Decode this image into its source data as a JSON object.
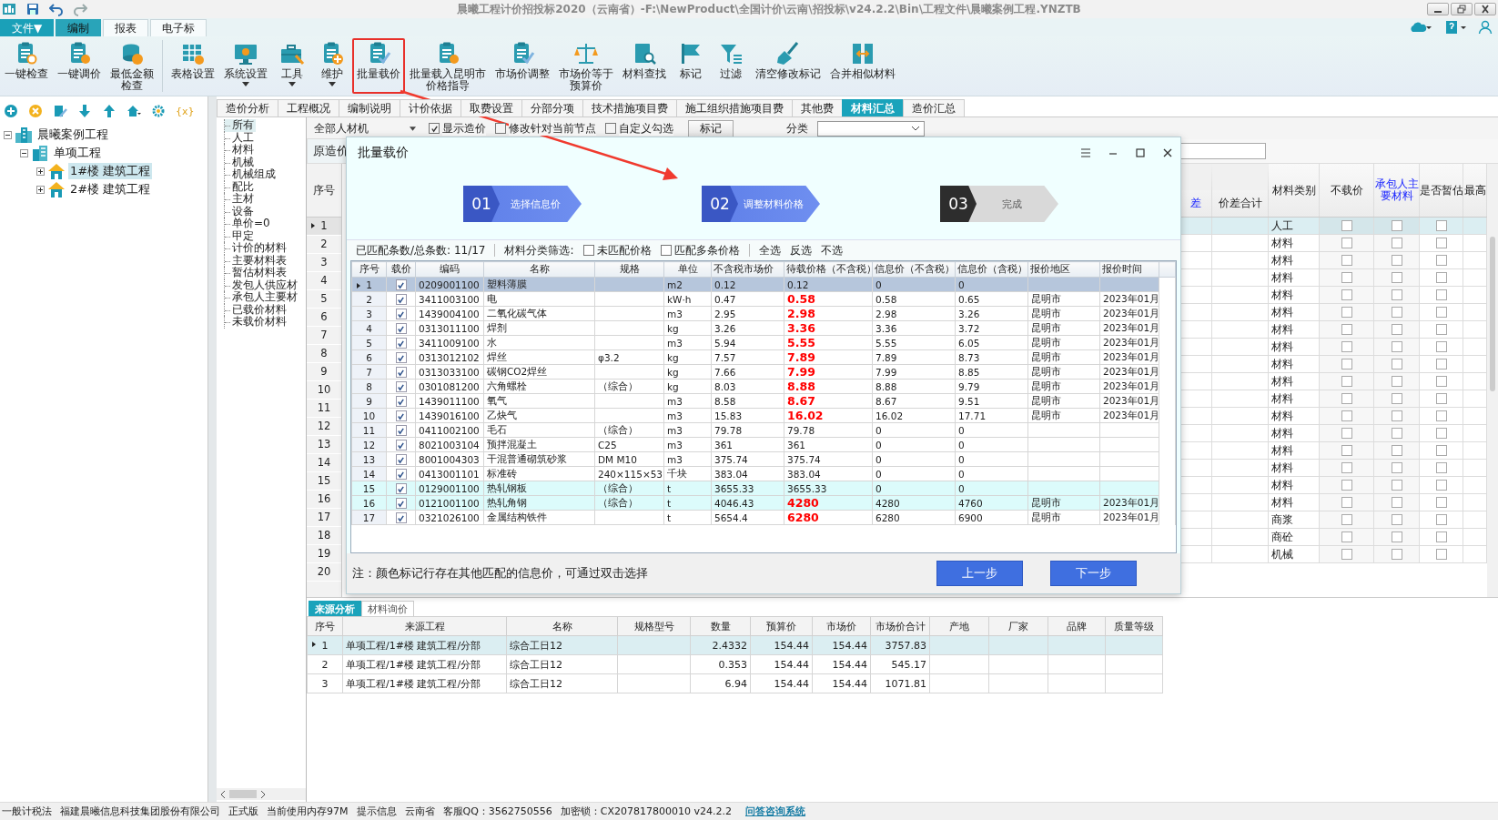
{
  "window": {
    "title": "晨曦工程计价招投标2020（云南省）-F:\\NewProduct\\全国计价\\云南\\招投标\\v24.2.2\\Bin\\工程文件\\晨曦案例工程.YNZTB"
  },
  "menu_tabs": [
    {
      "label": "文件▼",
      "kind": "file",
      "selected": false
    },
    {
      "label": "编制",
      "kind": "tab",
      "selected": true
    },
    {
      "label": "报表",
      "kind": "tab",
      "selected": false
    },
    {
      "label": "电子标",
      "kind": "tab",
      "selected": false
    }
  ],
  "ribbon": [
    {
      "items": [
        {
          "lines": [
            "一键检查"
          ],
          "dropdown": false,
          "highlighted": false
        },
        {
          "lines": [
            "一键调价"
          ],
          "dropdown": false,
          "highlighted": false
        },
        {
          "lines": [
            "最低金额",
            "检查"
          ],
          "dropdown": false,
          "highlighted": false
        }
      ]
    },
    {
      "items": [
        {
          "lines": [
            "表格设置"
          ],
          "dropdown": false,
          "highlighted": false
        },
        {
          "lines": [
            "系统设置"
          ],
          "dropdown": true,
          "highlighted": false
        },
        {
          "lines": [
            "工具"
          ],
          "dropdown": true,
          "highlighted": false
        },
        {
          "lines": [
            "维护"
          ],
          "dropdown": true,
          "highlighted": false
        },
        {
          "lines": [
            "批量载价"
          ],
          "dropdown": false,
          "highlighted": true
        },
        {
          "lines": [
            "批量载入昆明市",
            "价格指导"
          ],
          "dropdown": false,
          "highlighted": false
        },
        {
          "lines": [
            "市场价调整"
          ],
          "dropdown": false,
          "highlighted": false
        },
        {
          "lines": [
            "市场价等于",
            "预算价"
          ],
          "dropdown": false,
          "highlighted": false
        },
        {
          "lines": [
            "材料查找"
          ],
          "dropdown": false,
          "highlighted": false
        },
        {
          "lines": [
            "标记"
          ],
          "dropdown": false,
          "highlighted": false
        },
        {
          "lines": [
            "过滤"
          ],
          "dropdown": false,
          "highlighted": false
        },
        {
          "lines": [
            "清空修改标记"
          ],
          "dropdown": false,
          "highlighted": false
        },
        {
          "lines": [
            "合并相似材料"
          ],
          "dropdown": false,
          "highlighted": false
        }
      ]
    }
  ],
  "left_toolbar": {
    "tools": [
      {
        "kind": "add"
      },
      {
        "kind": "remove"
      },
      {
        "kind": "edit"
      },
      {
        "kind": "down"
      },
      {
        "kind": "up"
      },
      {
        "kind": "home"
      },
      {
        "kind": "gear"
      }
    ],
    "variable_button": "{x}"
  },
  "tree": {
    "nodes": [
      {
        "label": "晨曦案例工程",
        "kind": "project",
        "expanded": true,
        "selected": false,
        "children": [
          {
            "label": "单项工程",
            "kind": "building",
            "expanded": true,
            "selected": false,
            "children": [
              {
                "label": "1#楼  建筑工程",
                "kind": "house",
                "expanded": false,
                "selected": true
              },
              {
                "label": "2#楼  建筑工程",
                "kind": "house",
                "expanded": false,
                "selected": false
              }
            ]
          }
        ]
      }
    ]
  },
  "main_tabs": [
    {
      "label": "造价分析",
      "selected": false
    },
    {
      "label": "工程概况",
      "selected": false
    },
    {
      "label": "编制说明",
      "selected": false
    },
    {
      "label": "计价依据",
      "selected": false
    },
    {
      "label": "取费设置",
      "selected": false
    },
    {
      "label": "分部分项",
      "selected": false
    },
    {
      "label": "技术措施项目费",
      "selected": false
    },
    {
      "label": "施工组织措施项目费",
      "selected": false
    },
    {
      "label": "其他费",
      "selected": false
    },
    {
      "label": "材料汇总",
      "selected": true
    },
    {
      "label": "造价汇总",
      "selected": false
    }
  ],
  "filter_list": [
    {
      "label": "所有",
      "selected": true
    },
    {
      "label": "人工",
      "selected": false
    },
    {
      "label": "材料",
      "selected": false
    },
    {
      "label": "机械",
      "selected": false
    },
    {
      "label": "机械组成",
      "selected": false
    },
    {
      "label": "配比",
      "selected": false
    },
    {
      "label": "主材",
      "selected": false
    },
    {
      "label": "设备",
      "selected": false
    },
    {
      "label": "单价=0",
      "selected": false
    },
    {
      "label": "甲定",
      "selected": false
    },
    {
      "label": "计价的材料",
      "selected": false
    },
    {
      "label": "主要材料表",
      "selected": false
    },
    {
      "label": "暂估材料表",
      "selected": false
    },
    {
      "label": "发包人供应材",
      "selected": false
    },
    {
      "label": "承包人主要材",
      "selected": false
    },
    {
      "label": "已载价材料",
      "selected": false
    },
    {
      "label": "未载价材料",
      "selected": false
    }
  ],
  "filter_bar": {
    "material_select": "全部人材机",
    "options": [
      {
        "label": "显示造价",
        "checked": true
      },
      {
        "label": "修改针对当前节点",
        "checked": false
      },
      {
        "label": "自定义勾选",
        "checked": false
      }
    ],
    "mark_button": "标记",
    "category_label": "分类"
  },
  "material_grid": {
    "group_header": "原造价",
    "row_header": "序号",
    "columns": [
      {
        "label": "差",
        "emphasis": true,
        "kind": "text"
      },
      {
        "label": "价差合计",
        "emphasis": false,
        "kind": "text"
      },
      {
        "label": "材料类别",
        "emphasis": false,
        "kind": "category"
      },
      {
        "label": "不载价",
        "emphasis": false,
        "kind": "no_price"
      },
      {
        "label": "承包人主要材料",
        "emphasis": true,
        "kind": "contractor_main"
      },
      {
        "label": "是否暂估",
        "emphasis": false,
        "kind": "provisional"
      },
      {
        "label": "最高",
        "emphasis": false,
        "kind": "text"
      }
    ],
    "rows": [
      {
        "no": "1",
        "category": "人工",
        "selected": true,
        "no_price": false,
        "contractor_main": false,
        "provisional": false
      },
      {
        "no": "2",
        "category": "材料",
        "selected": false,
        "no_price": false,
        "contractor_main": false,
        "provisional": false
      },
      {
        "no": "3",
        "category": "材料",
        "selected": false,
        "no_price": false,
        "contractor_main": false,
        "provisional": false
      },
      {
        "no": "4",
        "category": "材料",
        "selected": false,
        "no_price": false,
        "contractor_main": false,
        "provisional": false
      },
      {
        "no": "5",
        "category": "材料",
        "selected": false,
        "no_price": false,
        "contractor_main": false,
        "provisional": false
      },
      {
        "no": "6",
        "category": "材料",
        "selected": false,
        "no_price": false,
        "contractor_main": false,
        "provisional": false
      },
      {
        "no": "7",
        "category": "材料",
        "selected": false,
        "no_price": false,
        "contractor_main": false,
        "provisional": false
      },
      {
        "no": "8",
        "category": "材料",
        "selected": false,
        "no_price": false,
        "contractor_main": false,
        "provisional": false
      },
      {
        "no": "9",
        "category": "材料",
        "selected": false,
        "no_price": false,
        "contractor_main": false,
        "provisional": false
      },
      {
        "no": "10",
        "category": "材料",
        "selected": false,
        "no_price": false,
        "contractor_main": false,
        "provisional": false
      },
      {
        "no": "11",
        "category": "材料",
        "selected": false,
        "no_price": false,
        "contractor_main": false,
        "provisional": false
      },
      {
        "no": "12",
        "category": "材料",
        "selected": false,
        "no_price": false,
        "contractor_main": false,
        "provisional": false
      },
      {
        "no": "13",
        "category": "材料",
        "selected": false,
        "no_price": false,
        "contractor_main": false,
        "provisional": false
      },
      {
        "no": "14",
        "category": "材料",
        "selected": false,
        "no_price": false,
        "contractor_main": false,
        "provisional": false
      },
      {
        "no": "15",
        "category": "材料",
        "selected": false,
        "no_price": false,
        "contractor_main": false,
        "provisional": false
      },
      {
        "no": "16",
        "category": "材料",
        "selected": false,
        "no_price": false,
        "contractor_main": false,
        "provisional": false
      },
      {
        "no": "17",
        "category": "材料",
        "selected": false,
        "no_price": false,
        "contractor_main": false,
        "provisional": false
      },
      {
        "no": "18",
        "category": "商浆",
        "selected": false,
        "no_price": false,
        "contractor_main": false,
        "provisional": false
      },
      {
        "no": "19",
        "category": "商砼",
        "selected": false,
        "no_price": false,
        "contractor_main": false,
        "provisional": false
      },
      {
        "no": "20",
        "category": "机械",
        "selected": false,
        "no_price": false,
        "contractor_main": false,
        "provisional": false
      }
    ]
  },
  "dialog": {
    "title": "批量载价",
    "steps": [
      {
        "number": "01",
        "label": "选择信息价",
        "active": true
      },
      {
        "number": "02",
        "label": "调整材料价格",
        "active": true
      },
      {
        "number": "03",
        "label": "完成",
        "active": false
      }
    ],
    "match_count": "已匹配条数/总条数:  11/17",
    "category_filter_label": "材料分类筛选:",
    "filters": [
      {
        "label": "未匹配价格",
        "checked": false
      },
      {
        "label": "匹配多条价格",
        "checked": false
      }
    ],
    "select_actions": [
      "全选",
      "反选",
      "不选"
    ],
    "columns": [
      "序号",
      "载价",
      "编码",
      "名称",
      "规格",
      "单位",
      "不含税市场价",
      "待载价格（不含税）",
      "信息价（不含税）",
      "信息价（含税）",
      "报价地区",
      "报价时间"
    ],
    "rows": [
      {
        "no": "1",
        "checked": true,
        "code": "0209001100",
        "name": "塑料薄膜",
        "unit": "m2",
        "market": "0.12",
        "pending": "0.12",
        "info_ex": "0",
        "info_in": "0",
        "changed": false,
        "marked": false,
        "selected": true
      },
      {
        "no": "2",
        "checked": true,
        "code": "3411003100",
        "name": "电",
        "unit": "kW·h",
        "market": "0.47",
        "pending": "0.58",
        "info_ex": "0.58",
        "info_in": "0.65",
        "region": "昆明市",
        "time": "2023年01月",
        "changed": true,
        "marked": false,
        "selected": false
      },
      {
        "no": "3",
        "checked": true,
        "code": "1439004100",
        "name": "二氧化碳气体",
        "unit": "m3",
        "market": "2.95",
        "pending": "2.98",
        "info_ex": "2.98",
        "info_in": "3.26",
        "region": "昆明市",
        "time": "2023年01月",
        "changed": true,
        "marked": false,
        "selected": false
      },
      {
        "no": "4",
        "checked": true,
        "code": "0313011100",
        "name": "焊剂",
        "unit": "kg",
        "market": "3.26",
        "pending": "3.36",
        "info_ex": "3.36",
        "info_in": "3.72",
        "region": "昆明市",
        "time": "2023年01月",
        "changed": true,
        "marked": false,
        "selected": false
      },
      {
        "no": "5",
        "checked": true,
        "code": "3411009100",
        "name": "水",
        "unit": "m3",
        "market": "5.94",
        "pending": "5.55",
        "info_ex": "5.55",
        "info_in": "6.05",
        "region": "昆明市",
        "time": "2023年01月",
        "changed": true,
        "marked": false,
        "selected": false
      },
      {
        "no": "6",
        "checked": true,
        "code": "0313012102",
        "name": "焊丝",
        "spec": "φ3.2",
        "unit": "kg",
        "market": "7.57",
        "pending": "7.89",
        "info_ex": "7.89",
        "info_in": "8.73",
        "region": "昆明市",
        "time": "2023年01月",
        "changed": true,
        "marked": false,
        "selected": false
      },
      {
        "no": "7",
        "checked": true,
        "code": "0313033100",
        "name": "碳钢CO2焊丝",
        "unit": "kg",
        "market": "7.66",
        "pending": "7.99",
        "info_ex": "7.99",
        "info_in": "8.85",
        "region": "昆明市",
        "time": "2023年01月",
        "changed": true,
        "marked": false,
        "selected": false
      },
      {
        "no": "8",
        "checked": true,
        "code": "0301081200",
        "name": "六角螺栓",
        "spec": "（综合）",
        "unit": "kg",
        "market": "8.03",
        "pending": "8.88",
        "info_ex": "8.88",
        "info_in": "9.79",
        "region": "昆明市",
        "time": "2023年01月",
        "changed": true,
        "marked": false,
        "selected": false
      },
      {
        "no": "9",
        "checked": true,
        "code": "1439011100",
        "name": "氧气",
        "unit": "m3",
        "market": "8.58",
        "pending": "8.67",
        "info_ex": "8.67",
        "info_in": "9.51",
        "region": "昆明市",
        "time": "2023年01月",
        "changed": true,
        "marked": false,
        "selected": false
      },
      {
        "no": "10",
        "checked": true,
        "code": "1439016100",
        "name": "乙炔气",
        "unit": "m3",
        "market": "15.83",
        "pending": "16.02",
        "info_ex": "16.02",
        "info_in": "17.71",
        "region": "昆明市",
        "time": "2023年01月",
        "changed": true,
        "marked": false,
        "selected": false
      },
      {
        "no": "11",
        "checked": true,
        "code": "0411002100",
        "name": "毛石",
        "spec": "（综合）",
        "unit": "m3",
        "market": "79.78",
        "pending": "79.78",
        "info_ex": "0",
        "info_in": "0",
        "changed": false,
        "marked": false,
        "selected": false
      },
      {
        "no": "12",
        "checked": true,
        "code": "8021003104",
        "name": "预拌混凝土",
        "spec": "C25",
        "unit": "m3",
        "market": "361",
        "pending": "361",
        "info_ex": "0",
        "info_in": "0",
        "changed": false,
        "marked": false,
        "selected": false
      },
      {
        "no": "13",
        "checked": true,
        "code": "8001004303",
        "name": "干混普通砌筑砂浆",
        "spec": "DM M10",
        "unit": "m3",
        "market": "375.74",
        "pending": "375.74",
        "info_ex": "0",
        "info_in": "0",
        "changed": false,
        "marked": false,
        "selected": false
      },
      {
        "no": "14",
        "checked": true,
        "code": "0413001101",
        "name": "标准砖",
        "spec": "240×115×53",
        "unit": "千块",
        "market": "383.04",
        "pending": "383.04",
        "info_ex": "0",
        "info_in": "0",
        "changed": false,
        "marked": false,
        "selected": false
      },
      {
        "no": "15",
        "checked": true,
        "code": "0129001100",
        "name": "热轧钢板",
        "spec": "（综合）",
        "unit": "t",
        "market": "3655.33",
        "pending": "3655.33",
        "info_ex": "0",
        "info_in": "0",
        "changed": false,
        "marked": true,
        "selected": false
      },
      {
        "no": "16",
        "checked": true,
        "code": "0121001100",
        "name": "热轧角钢",
        "spec": "（综合）",
        "unit": "t",
        "market": "4046.43",
        "pending": "4280",
        "info_ex": "4280",
        "info_in": "4760",
        "region": "昆明市",
        "time": "2023年01月",
        "changed": true,
        "marked": true,
        "selected": false
      },
      {
        "no": "17",
        "checked": true,
        "code": "0321026100",
        "name": "金属结构铁件",
        "unit": "t",
        "market": "5654.4",
        "pending": "6280",
        "info_ex": "6280",
        "info_in": "6900",
        "region": "昆明市",
        "time": "2023年01月",
        "changed": true,
        "marked": false,
        "selected": false
      }
    ],
    "note": "注：颜色标记行存在其他匹配的信息价，可通过双击选择",
    "back_button": "上一步",
    "next_button": "下一步"
  },
  "bottom_tabs": [
    {
      "label": "来源分析",
      "selected": true
    },
    {
      "label": "材料询价",
      "selected": false
    }
  ],
  "source_table": {
    "columns": [
      "序号",
      "来源工程",
      "名称",
      "规格型号",
      "数量",
      "预算价",
      "市场价",
      "市场价合计",
      "产地",
      "厂家",
      "品牌",
      "质量等级"
    ],
    "rows": [
      {
        "no": "1",
        "project": "单项工程/1#楼 建筑工程/分部",
        "name": "综合工日12",
        "qty": "2.4332",
        "budget": "154.44",
        "market": "154.44",
        "total": "3757.83",
        "selected": true
      },
      {
        "no": "2",
        "project": "单项工程/1#楼 建筑工程/分部",
        "name": "综合工日12",
        "qty": "0.353",
        "budget": "154.44",
        "market": "154.44",
        "total": "545.17",
        "selected": false
      },
      {
        "no": "3",
        "project": "单项工程/1#楼 建筑工程/分部",
        "name": "综合工日12",
        "qty": "6.94",
        "budget": "154.44",
        "market": "154.44",
        "total": "1071.81",
        "selected": false
      }
    ]
  },
  "status_bar": {
    "items": [
      "一般计税法",
      "福建晨曦信息科技集团股份有限公司",
      "正式版",
      "当前使用内存97M",
      "提示信息",
      "云南省",
      "客服QQ：3562750556",
      "加密锁：CX207817800010 v24.2.2"
    ],
    "link": "问答咨询系统"
  }
}
